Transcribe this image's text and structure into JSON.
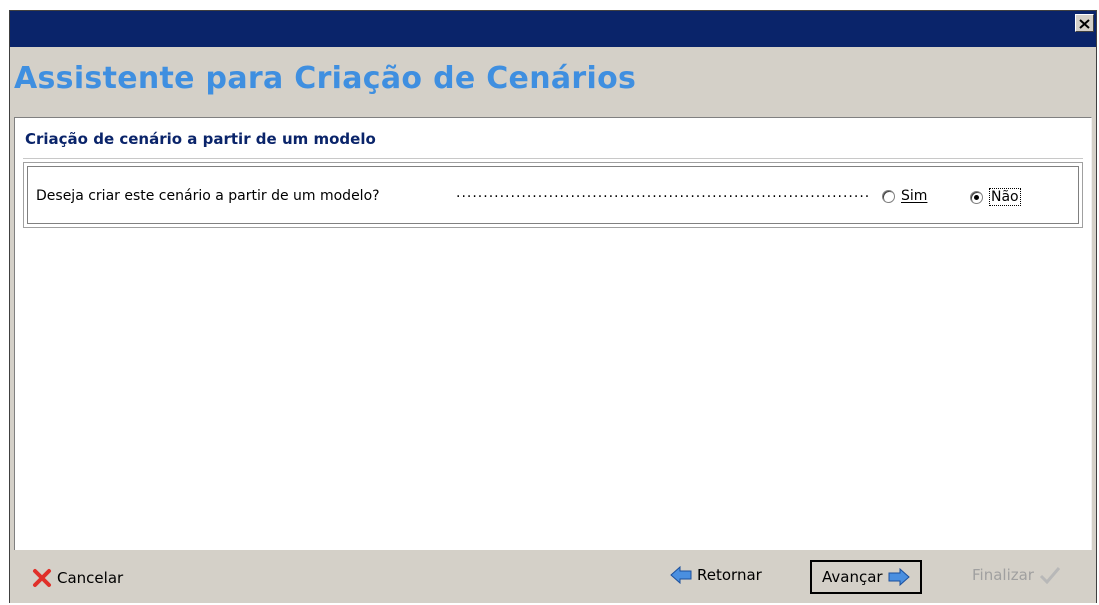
{
  "window": {
    "title": "Assistente para Criação de Cenários",
    "close_icon": "close-icon"
  },
  "section": {
    "title": "Criação de cenário a partir de um modelo"
  },
  "question": {
    "label": "Deseja criar este cenário a partir de um modelo?",
    "dots": "........................................................................................",
    "options": [
      {
        "label": "Sim",
        "selected": false
      },
      {
        "label": "Não",
        "selected": true
      }
    ]
  },
  "footer": {
    "cancel_label": "Cancelar",
    "back_label": "Retornar",
    "next_label": "Avançar",
    "finish_label": "Finalizar"
  },
  "colors": {
    "titlebar": "#0a246a",
    "title_text": "#3f8fe0",
    "section_text": "#0a246a"
  }
}
